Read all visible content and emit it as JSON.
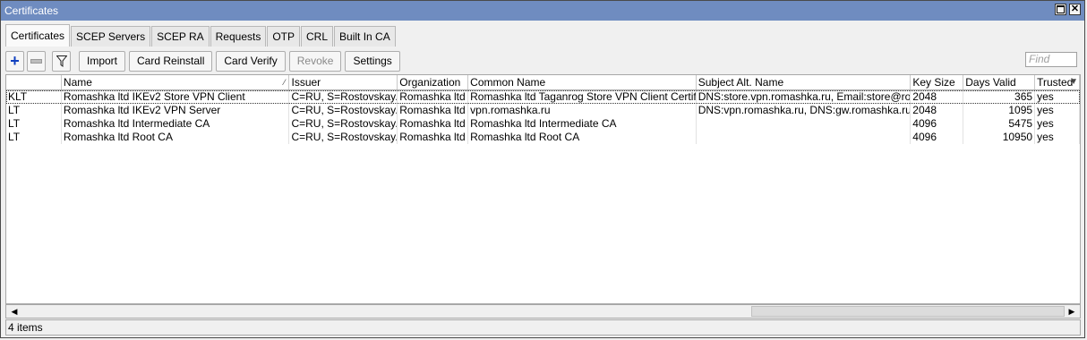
{
  "window": {
    "title": "Certificates"
  },
  "tabs": [
    "Certificates",
    "SCEP Servers",
    "SCEP RA",
    "Requests",
    "OTP",
    "CRL",
    "Built In CA"
  ],
  "toolbar": {
    "import": "Import",
    "card_reinstall": "Card Reinstall",
    "card_verify": "Card Verify",
    "revoke": "Revoke",
    "settings": "Settings",
    "find_placeholder": "Find"
  },
  "table": {
    "columns": [
      "",
      "Name",
      "Issuer",
      "Organization",
      "Common Name",
      "Subject Alt. Name",
      "Key Size",
      "Days Valid",
      "Trusted"
    ],
    "rows": [
      [
        "KLT",
        "Romashka ltd IKEv2 Store VPN Client",
        "C=RU, S=Rostovskay...",
        "Romashka ltd",
        "Romashka ltd Taganrog Store VPN Client Certificate",
        "DNS:store.vpn.romashka.ru, Email:store@roma...",
        "2048",
        "365",
        "yes"
      ],
      [
        "LT",
        "Romashka ltd IKEv2 VPN Server",
        "C=RU, S=Rostovskay...",
        "Romashka ltd",
        "vpn.romashka.ru",
        "DNS:vpn.romashka.ru, DNS:gw.romashka.ru, I...",
        "2048",
        "1095",
        "yes"
      ],
      [
        "LT",
        "Romashka ltd Intermediate CA",
        "C=RU, S=Rostovskay...",
        "Romashka ltd",
        "Romashka ltd Intermediate CA",
        "",
        "4096",
        "5475",
        "yes"
      ],
      [
        "LT",
        "Romashka ltd Root CA",
        "C=RU, S=Rostovskay...",
        "Romashka ltd",
        "Romashka ltd Root CA",
        "",
        "4096",
        "10950",
        "yes"
      ]
    ]
  },
  "status": {
    "count": "4 items"
  }
}
